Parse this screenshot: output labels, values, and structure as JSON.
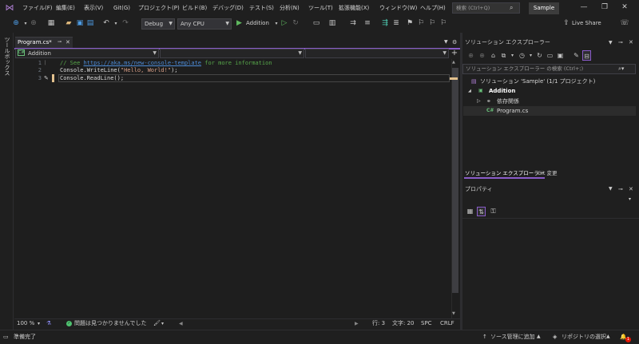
{
  "menu": {
    "items": [
      "ファイル(F)",
      "編集(E)",
      "表示(V)",
      "Git(G)",
      "プロジェクト(P)",
      "ビルド(B)",
      "デバッグ(D)",
      "テスト(S)",
      "分析(N)",
      "ツール(T)",
      "拡張機能(X)",
      "ウィンドウ(W)",
      "ヘルプ(H)"
    ],
    "search_placeholder": "検索 (Ctrl+Q)",
    "solution_name": "Sample"
  },
  "toolbar": {
    "config": "Debug",
    "platform": "Any CPU",
    "run_target": "Addition",
    "live_share": "Live Share"
  },
  "toolbox": {
    "label": "ツールボックス"
  },
  "editor": {
    "tab_label": "Program.cs*",
    "nav_project": "Addition",
    "lines": [
      {
        "no": "1",
        "comment": "// See ",
        "link": "https://aka.ms/new-console-template",
        "comment_tail": " for more information"
      },
      {
        "no": "2",
        "pre": "Console.WriteLine(",
        "str": "\"Hello, World!\"",
        "post": ");"
      },
      {
        "no": "3",
        "text": "Console.ReadLine();"
      }
    ]
  },
  "editor_status": {
    "zoom": "100 %",
    "issues": "問題は見つかりませんでした",
    "line": "行: 3",
    "col": "文字: 20",
    "spc": "SPC",
    "crlf": "CRLF"
  },
  "solution_explorer": {
    "title": "ソリューション エクスプローラー",
    "search_placeholder": "ソリューション エクスプローラー の検索 (Ctrl+;)",
    "tree": {
      "solution": "ソリューション 'Sample' (1/1 プロジェクト)",
      "project": "Addition",
      "dependencies": "依存関係",
      "file": "Program.cs"
    },
    "tabs": [
      "ソリューション エクスプローラー",
      "Git 変更"
    ]
  },
  "properties": {
    "title": "プロパティ"
  },
  "statusbar": {
    "ready": "準備完了",
    "source_control": "ソース管理に追加",
    "repo": "リポジトリの選択",
    "notifications": "1"
  }
}
